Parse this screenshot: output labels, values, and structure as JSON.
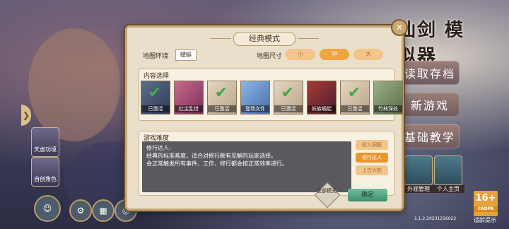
{
  "right_menu": {
    "logo": "仙剑\n模拟器",
    "load_save": "读取存档",
    "new_game": "新游戏",
    "basic_tutorial": "基础教学",
    "shortcut_1": "外观管理",
    "shortcut_2": "个人主页"
  },
  "left_side": {
    "card_1": "天虚功境",
    "card_2": "自创角色"
  },
  "dialog": {
    "title": "经典模式",
    "env_label": "地图环境",
    "env_value": "蜻蜓",
    "size_label": "地图尺寸",
    "sizes": [
      "小",
      "中",
      "大"
    ],
    "content_title": "内容选择",
    "cards": [
      {
        "label": "已激活"
      },
      {
        "label": "红尘乱世"
      },
      {
        "label": "已激活"
      },
      {
        "label": "登场文件"
      },
      {
        "label": "已激活"
      },
      {
        "label": "妖族崛起"
      },
      {
        "label": "已激活"
      },
      {
        "label": "竹林深处"
      }
    ],
    "difficulty_title": "游戏难度",
    "difficulty_name": "修行达人:",
    "difficulty_desc_1": "经典的标准难度，适合对修行颇有见解的玩家选择。",
    "difficulty_desc_2": "会正常触发所有事件、工作、修行都会按正常效率进行。",
    "difficulty_options": [
      "初入洞庭",
      "修行达人",
      "上古大能"
    ],
    "mode_icon_text": "全部模式",
    "confirm": "确定"
  },
  "age_rating": "16+",
  "age_sub": "CADPA",
  "age_tip": "适龄提示",
  "version": "1.1.2.20231216022",
  "colors": {
    "accent": "#f0a53e",
    "confirm": "#3e8f6a"
  }
}
